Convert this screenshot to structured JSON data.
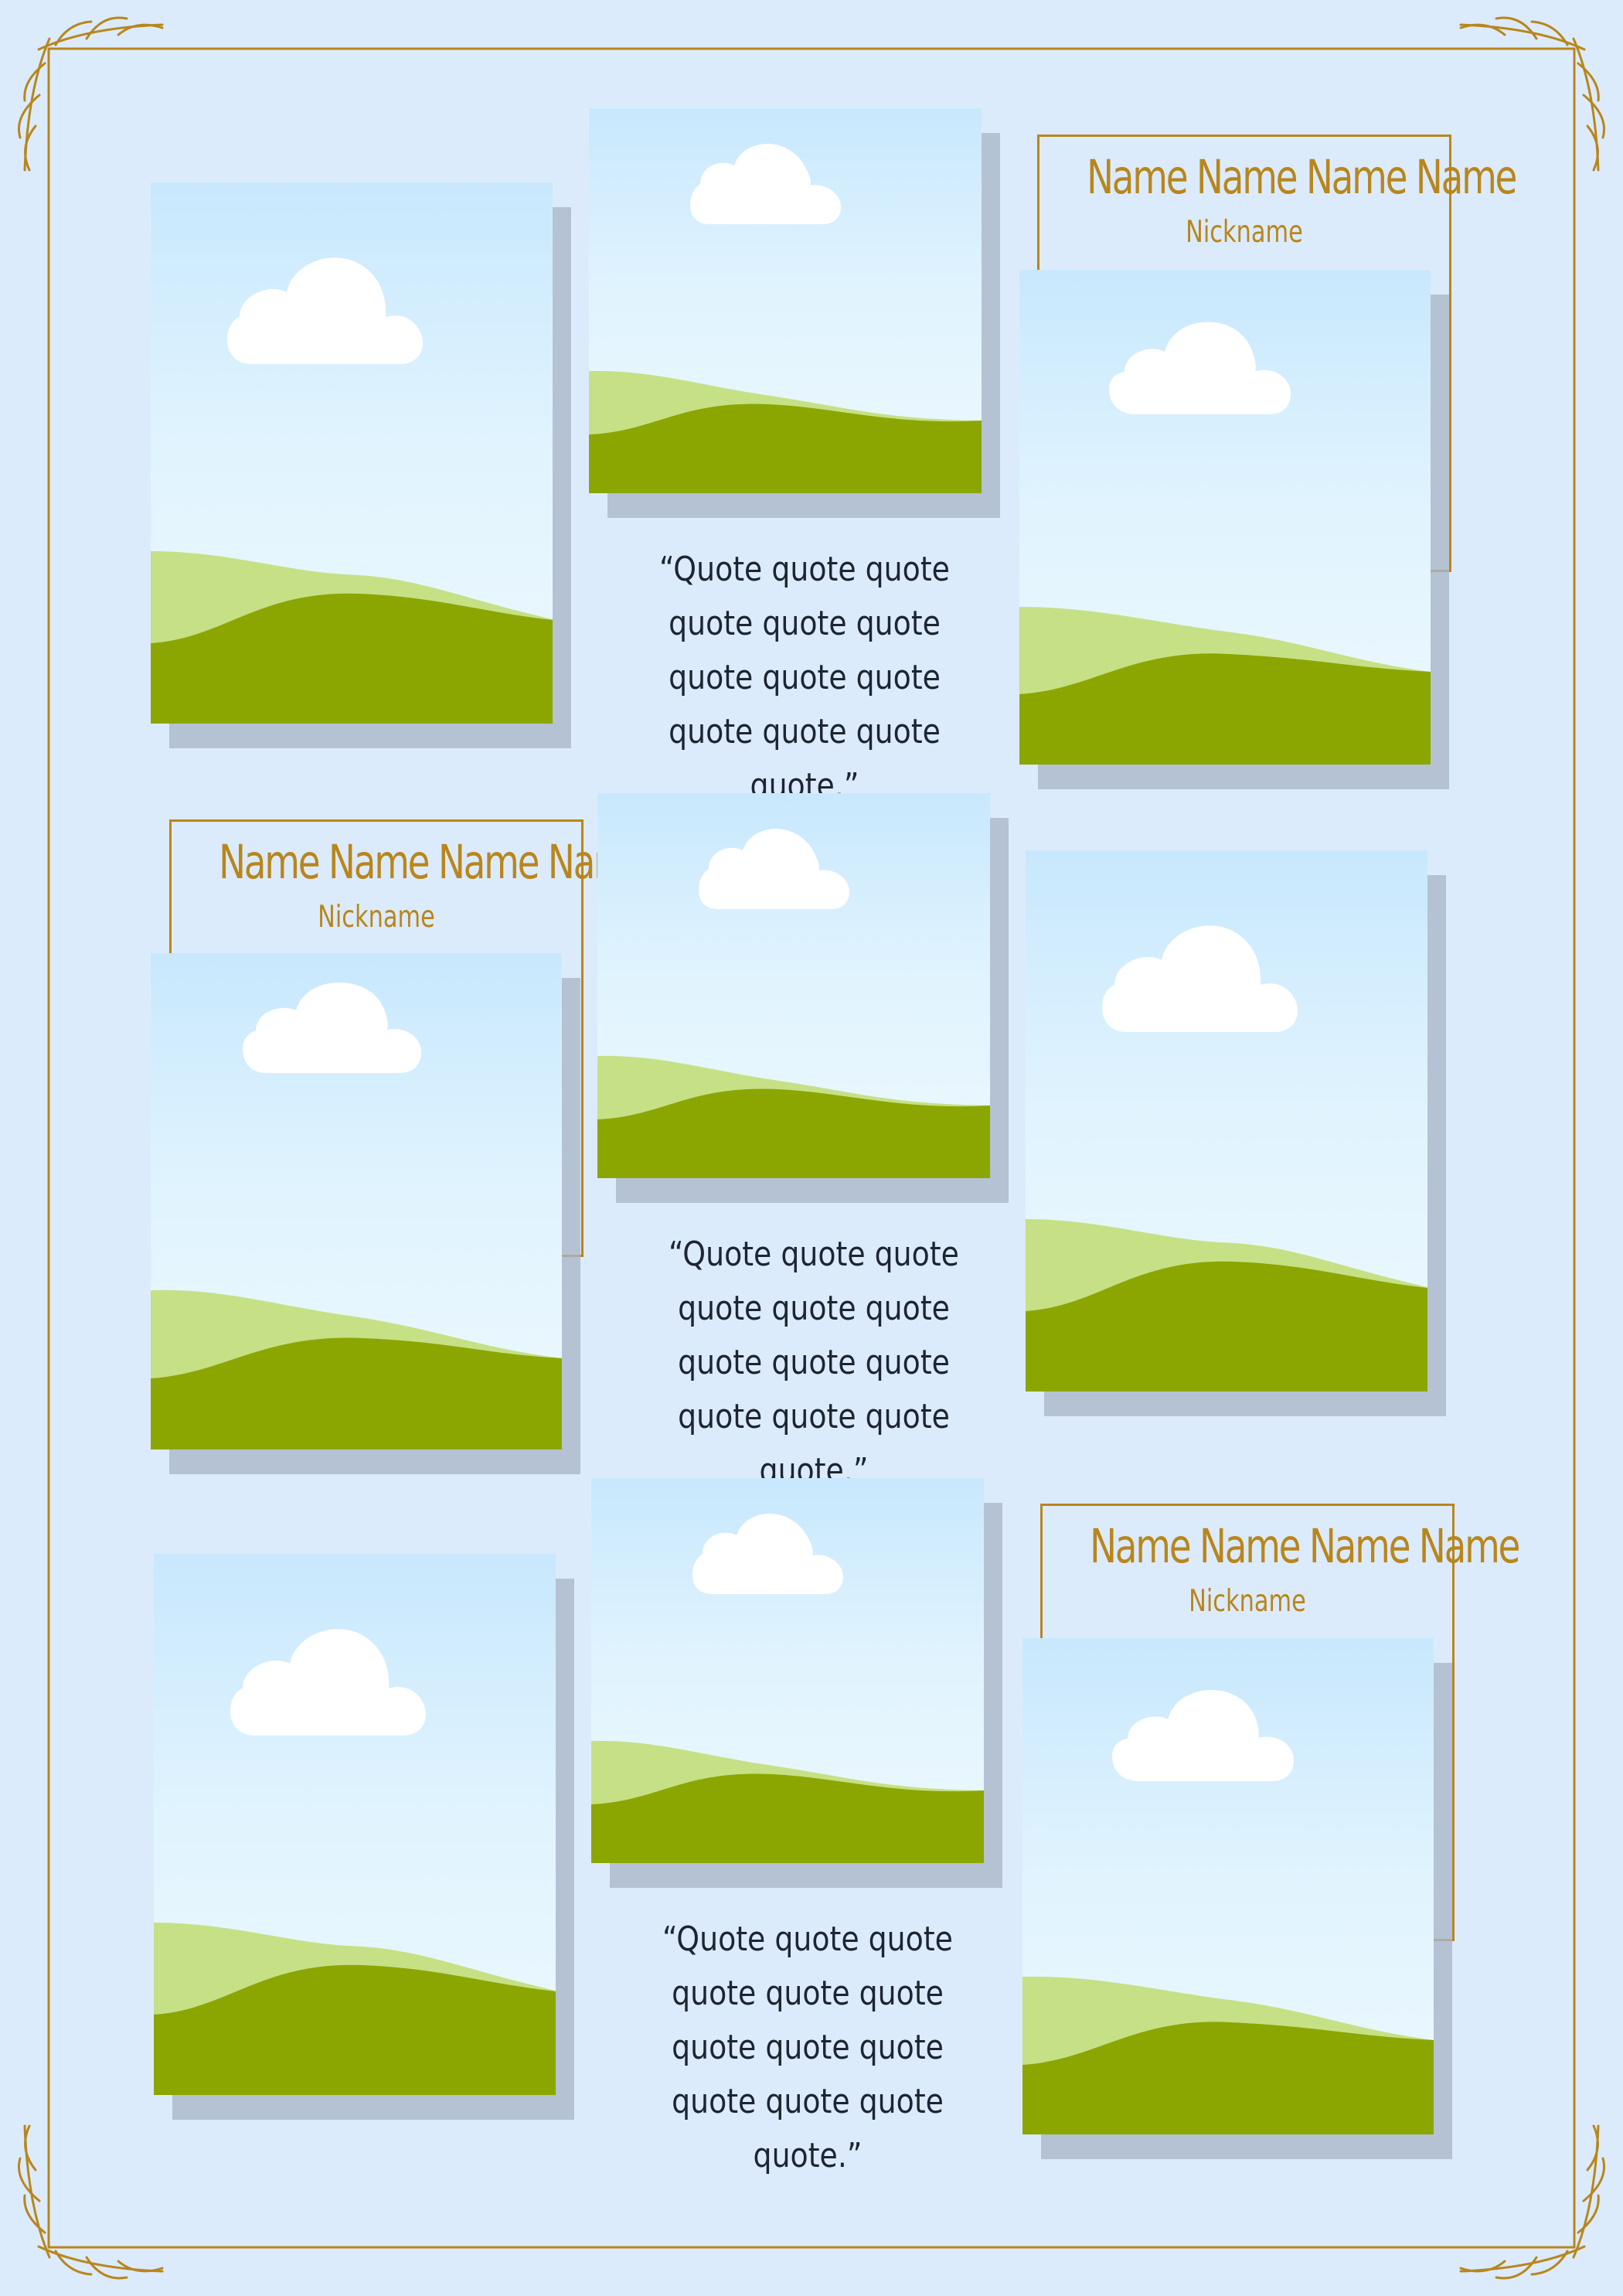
{
  "colors": {
    "background": "#dcebfc",
    "gold": "#b8861c",
    "sky_top": "#c8e8fd",
    "sky_bottom": "#eef9ff",
    "light_hill": "#c6e086",
    "dark_hill": "#8ba600",
    "shadow": "#aab6c8",
    "quote_text": "#1d2532"
  },
  "decorations": {
    "frame": "gold-line-frame",
    "corner_ornament": "laurel-branch-icon",
    "image_icon": "landscape-placeholder-icon"
  },
  "groups": [
    {
      "name": "Name Name Name Name",
      "nickname": "Nickname",
      "quote": "“Quote quote quote quote quote quote quote quote quote quote quote quote quote.”"
    },
    {
      "name": "Name Name Name Name",
      "nickname": "Nickname",
      "quote": "“Quote quote quote quote quote quote quote quote quote quote quote quote quote.”"
    },
    {
      "name": "Name Name Name Name",
      "nickname": "Nickname",
      "quote": "“Quote quote quote quote quote quote quote quote quote quote quote quote quote.”"
    }
  ]
}
